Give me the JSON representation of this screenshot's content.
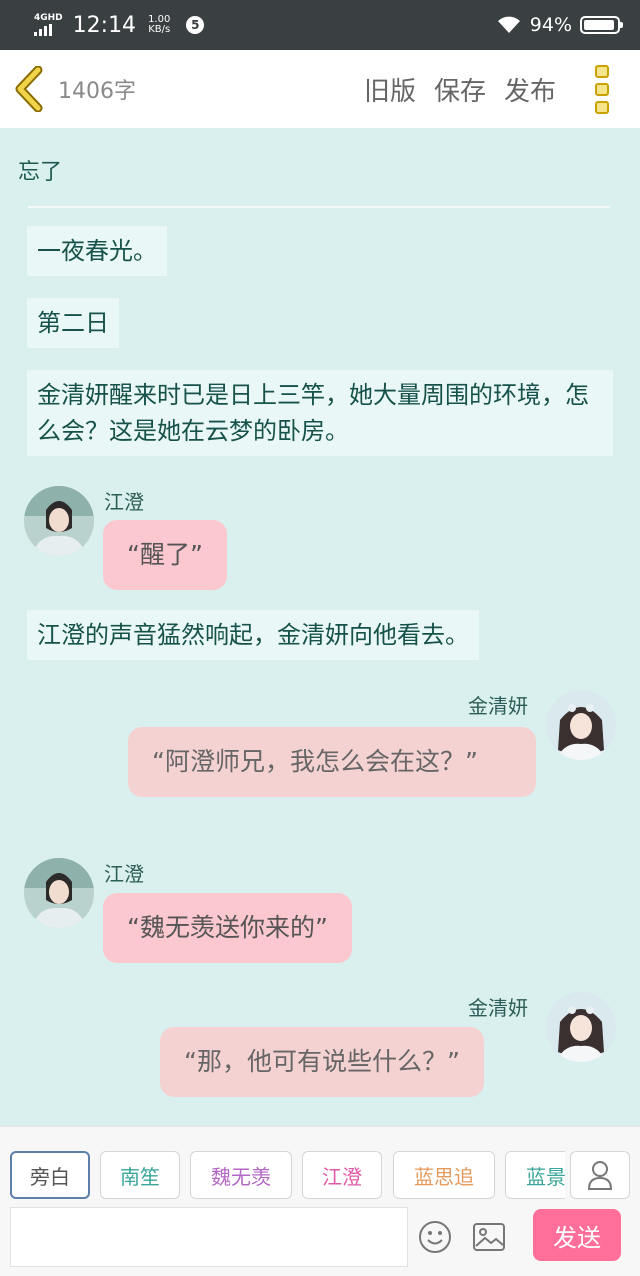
{
  "status_bar": {
    "network": "4GHD",
    "time": "12:14",
    "speed_value": "1.00",
    "speed_unit": "KB/s",
    "notification_count": "5",
    "battery": "94%",
    "battery_level": 0.94
  },
  "header": {
    "word_count": "1406字",
    "old_version": "旧版",
    "save": "保存",
    "publish": "发布"
  },
  "story": {
    "title": "忘了",
    "narr1": "一夜春光。",
    "narr2": "第二日",
    "narr3": "金清妍醒来时已是日上三竿，她大量周围的环境，怎么会？这是她在云梦的卧房。",
    "narr4": "江澄的声音猛然响起，金清妍向他看去。",
    "msg1_name": "江澄",
    "msg1_text": "“醒了”",
    "msg2_name": "金清妍",
    "msg2_text": "“阿澄师兄，我怎么会在这？”",
    "msg3_name": "江澄",
    "msg3_text": "“魏无羡送你来的”",
    "msg4_name": "金清妍",
    "msg4_text": "“那，他可有说些什么？”"
  },
  "roles": [
    "旁白",
    "南笙",
    "魏无羡",
    "江澄",
    "蓝思追",
    "蓝景仪"
  ],
  "send": "发送",
  "colors": {
    "chip_0": "#555555",
    "chip_1": "#3aa69b",
    "chip_2": "#b368c5",
    "chip_3": "#e05aa7",
    "chip_4": "#e39a5c",
    "chip_5": "#3aa69b",
    "send_button": "#ff6f9a"
  }
}
